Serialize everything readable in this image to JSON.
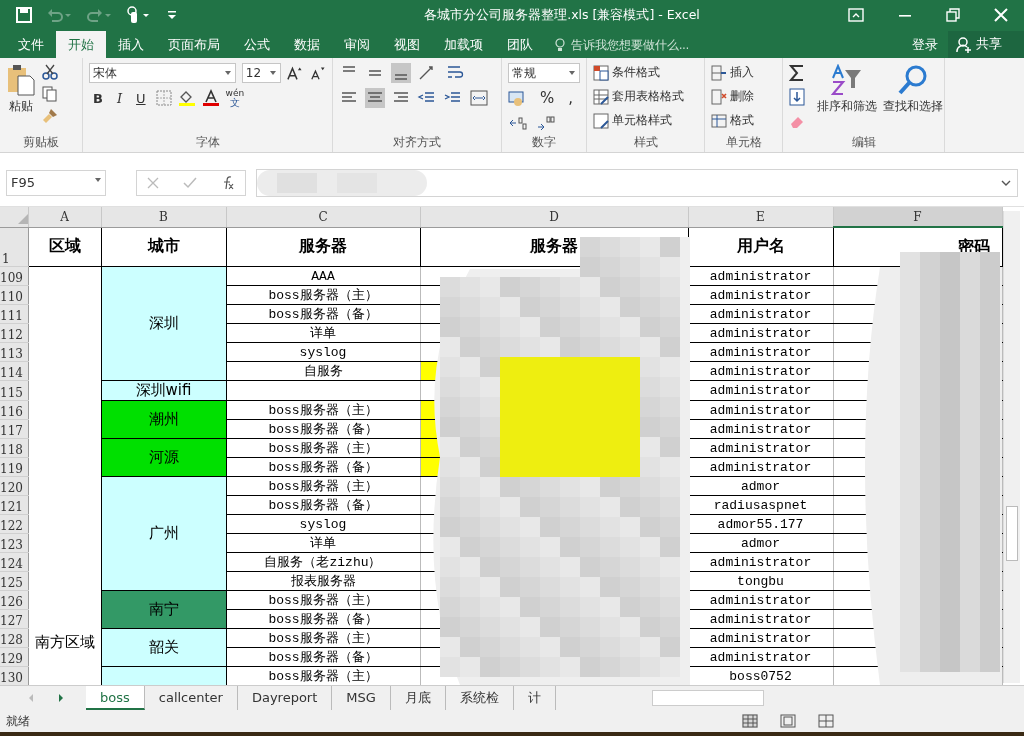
{
  "window": {
    "title": "各城市分公司服务器整理.xls  [兼容模式] - Excel"
  },
  "ribbon_tabs": [
    {
      "label": "文件",
      "selected": false
    },
    {
      "label": "开始",
      "selected": true
    },
    {
      "label": "插入",
      "selected": false
    },
    {
      "label": "页面布局",
      "selected": false
    },
    {
      "label": "公式",
      "selected": false
    },
    {
      "label": "数据",
      "selected": false
    },
    {
      "label": "审阅",
      "selected": false
    },
    {
      "label": "视图",
      "selected": false
    },
    {
      "label": "加载项",
      "selected": false
    },
    {
      "label": "团队",
      "selected": false
    }
  ],
  "tell_me": {
    "placeholder": "告诉我您想要做什么..."
  },
  "account": {
    "sign_in": "登录",
    "share": "共享"
  },
  "ribbon": {
    "paste": "粘贴",
    "font_name": "宋体",
    "font_size": "12",
    "bold": "B",
    "italic": "I",
    "underline": "U",
    "pinyin": "wén",
    "pinyin_char": "文",
    "number_format": "常规",
    "percent": "%",
    "comma": ",",
    "conditional": "条件格式",
    "table_format": "套用表格格式",
    "cell_styles": "单元格样式",
    "insert": "插入",
    "delete": "删除",
    "format": "格式",
    "sort": "排序和筛选",
    "find": "查找和选择",
    "groups": [
      "剪贴板",
      "字体",
      "对齐方式",
      "数字",
      "样式",
      "单元格",
      "编辑"
    ]
  },
  "name_box": "F95",
  "columns": [
    "A",
    "B",
    "C",
    "D",
    "E",
    "F"
  ],
  "header_row": {
    "number": "1",
    "cells": [
      "区域",
      "城市",
      "服务器",
      "服务器",
      "用户名",
      "密码"
    ]
  },
  "region": "南方区域",
  "cities": [
    {
      "name": "深圳",
      "color": "#ccffff",
      "rows": [
        {
          "number": "109",
          "server": "AAA",
          "highlighted": false,
          "user": "administrator"
        },
        {
          "number": "110",
          "server": "boss服务器（主）",
          "highlighted": false,
          "user": "administrator"
        },
        {
          "number": "111",
          "server": "boss服务器（备）",
          "highlighted": false,
          "user": "administrator"
        },
        {
          "number": "112",
          "server": "详单",
          "highlighted": false,
          "user": "administrator"
        },
        {
          "number": "113",
          "server": "syslog",
          "highlighted": false,
          "user": "administrator"
        },
        {
          "number": "114",
          "server": "自服务",
          "highlighted": true,
          "user": "administrator"
        }
      ]
    },
    {
      "name": "深圳wifi",
      "color": "#ccffff",
      "rows": [
        {
          "number": "115",
          "highlighted": false,
          "user": "administrator"
        }
      ]
    },
    {
      "name": "潮州",
      "color": "#00e000",
      "rows": [
        {
          "number": "116",
          "server": "boss服务器（主）",
          "highlighted": true,
          "user": "administrator"
        },
        {
          "number": "117",
          "server": "boss服务器（备）",
          "highlighted": true,
          "user": "administrator"
        }
      ]
    },
    {
      "name": "河源",
      "color": "#00e000",
      "rows": [
        {
          "number": "118",
          "server": "boss服务器（主）",
          "highlighted": true,
          "user": "administrator"
        },
        {
          "number": "119",
          "server": "boss服务器（备）",
          "highlighted": true,
          "user": "administrator"
        }
      ]
    },
    {
      "name": "广州",
      "color": "#ccffff",
      "rows": [
        {
          "number": "120",
          "server": "boss服务器（主）",
          "highlighted": false,
          "user": "admor"
        },
        {
          "number": "121",
          "server": "boss服务器（备）",
          "highlighted": false,
          "user": "radiusaspnet"
        },
        {
          "number": "122",
          "server": "syslog",
          "highlighted": false,
          "user": "admor55.177"
        },
        {
          "number": "123",
          "server": "详单",
          "highlighted": false,
          "user": "admor"
        },
        {
          "number": "124",
          "server": "自服务（老zizhu）",
          "highlighted": false,
          "user": "administrator"
        },
        {
          "number": "125",
          "server": "报表服务器",
          "highlighted": false,
          "user": "tongbu"
        }
      ]
    },
    {
      "name": "南宁",
      "color": "#339966",
      "rows": [
        {
          "number": "126",
          "server": "boss服务器（主）",
          "highlighted": false,
          "user": "administrator"
        },
        {
          "number": "127",
          "server": "boss服务器（备）",
          "highlighted": false,
          "user": "administrator"
        }
      ]
    },
    {
      "name": "韶关",
      "color": "#ccffff",
      "rows": [
        {
          "number": "128",
          "server": "boss服务器（主）",
          "highlighted": false,
          "user": "administrator"
        },
        {
          "number": "129",
          "server": "boss服务器（备）",
          "highlighted": false,
          "user": "administrator"
        }
      ]
    },
    {
      "color": "#ccffff",
      "rows": [
        {
          "number": "130",
          "server": "boss服务器（主）",
          "highlighted": false,
          "user": "boss0752"
        }
      ]
    }
  ],
  "sheet_tabs": [
    {
      "label": "boss",
      "selected": true
    },
    {
      "label": "callcenter",
      "selected": false
    },
    {
      "label": "Dayreport",
      "selected": false
    },
    {
      "label": "MSG",
      "selected": false
    },
    {
      "label": "月底",
      "selected": false
    },
    {
      "label": "系统检",
      "selected": false
    },
    {
      "label": "计",
      "selected": false
    }
  ],
  "status_bar": {
    "text": "就绪"
  }
}
